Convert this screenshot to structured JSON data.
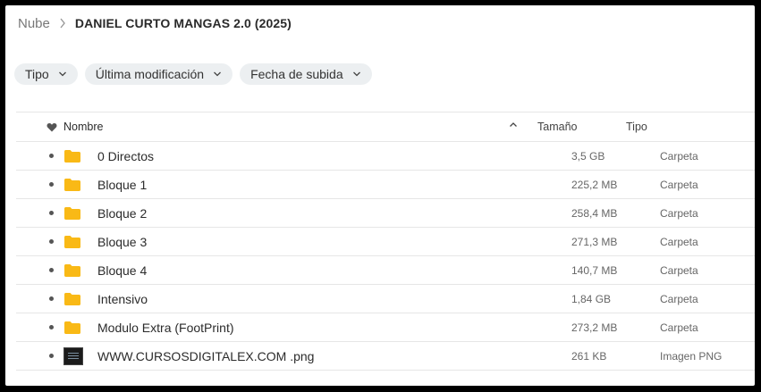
{
  "breadcrumb": {
    "root": "Nube",
    "current": "DANIEL CURTO MANGAS 2.0 (2025)"
  },
  "filters": [
    {
      "label": "Tipo"
    },
    {
      "label": "Última modificación"
    },
    {
      "label": "Fecha de subida"
    }
  ],
  "table": {
    "headers": {
      "name": "Nombre",
      "size": "Tamaño",
      "type": "Tipo"
    },
    "rows": [
      {
        "name": "0 Directos",
        "size": "3,5 GB",
        "type": "Carpeta",
        "icon": "folder-icon"
      },
      {
        "name": "Bloque 1",
        "size": "225,2 MB",
        "type": "Carpeta",
        "icon": "folder-icon"
      },
      {
        "name": "Bloque 2",
        "size": "258,4 MB",
        "type": "Carpeta",
        "icon": "folder-icon"
      },
      {
        "name": "Bloque 3",
        "size": "271,3 MB",
        "type": "Carpeta",
        "icon": "folder-icon"
      },
      {
        "name": "Bloque 4",
        "size": "140,7 MB",
        "type": "Carpeta",
        "icon": "folder-icon"
      },
      {
        "name": "Intensivo",
        "size": "1,84 GB",
        "type": "Carpeta",
        "icon": "folder-icon"
      },
      {
        "name": "Modulo Extra (FootPrint)",
        "size": "273,2 MB",
        "type": "Carpeta",
        "icon": "folder-icon"
      },
      {
        "name": "WWW.CURSOSDIGITALEX.COM .png",
        "size": "261 KB",
        "type": "Imagen PNG",
        "icon": "image-thumbnail-icon"
      }
    ]
  },
  "colors": {
    "folder": "#f9b916",
    "chip_bg": "#eceff1"
  }
}
